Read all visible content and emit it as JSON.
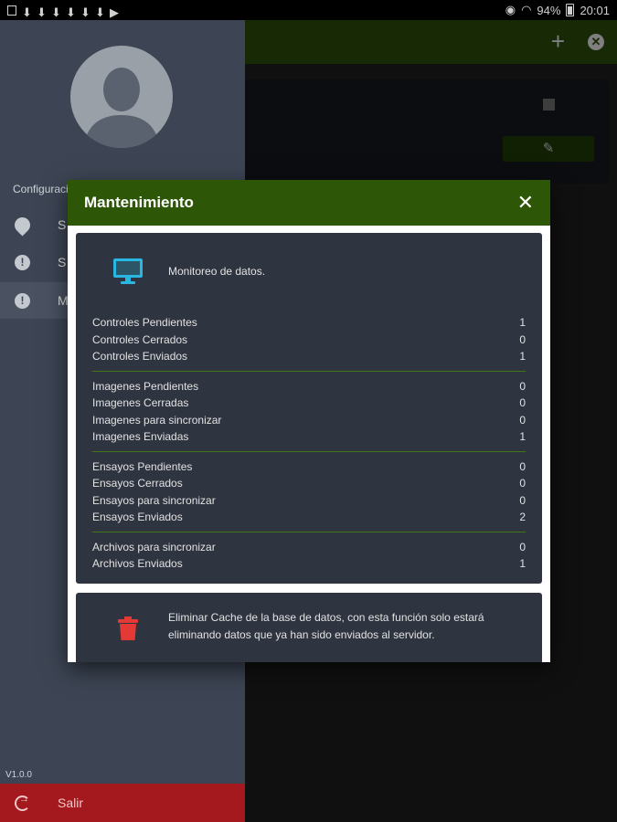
{
  "status_bar": {
    "battery": "94%",
    "time": "20:01"
  },
  "drawer": {
    "section_title": "Configuraci",
    "items": [
      {
        "label": "S",
        "icon": "drop-icon"
      },
      {
        "label": "S",
        "icon": "info-icon"
      },
      {
        "label": "M",
        "icon": "info-icon",
        "active": true
      }
    ],
    "version": "V1.0.0",
    "logout_label": "Salir"
  },
  "dialog": {
    "title": "Mantenimiento",
    "close_symbol": "✕",
    "monitor_label": "Monitoreo de datos.",
    "groups": [
      [
        {
          "label": "Controles Pendientes",
          "value": "1"
        },
        {
          "label": "Controles Cerrados",
          "value": "0"
        },
        {
          "label": "Controles Enviados",
          "value": "1"
        }
      ],
      [
        {
          "label": "Imagenes Pendientes",
          "value": "0"
        },
        {
          "label": "Imagenes Cerradas",
          "value": "0"
        },
        {
          "label": "Imagenes para sincronizar",
          "value": "0"
        },
        {
          "label": "Imagenes Enviadas",
          "value": "1"
        }
      ],
      [
        {
          "label": "Ensayos Pendientes",
          "value": "0"
        },
        {
          "label": "Ensayos Cerrados",
          "value": "0"
        },
        {
          "label": "Ensayos para sincronizar",
          "value": "0"
        },
        {
          "label": "Ensayos Enviados",
          "value": "2"
        }
      ],
      [
        {
          "label": "Archivos para sincronizar",
          "value": "0"
        },
        {
          "label": "Archivos Enviados",
          "value": "1"
        }
      ]
    ],
    "cache_text": "Eliminar Cache de la base de datos, con esta función solo estará eliminando datos que ya han sido enviados al servidor."
  },
  "colors": {
    "header_green": "#2e5607",
    "panel_bg": "#2f3441",
    "monitor_icon": "#29b6e0",
    "trash_icon": "#e53935",
    "logout_bg": "#a3191d"
  }
}
